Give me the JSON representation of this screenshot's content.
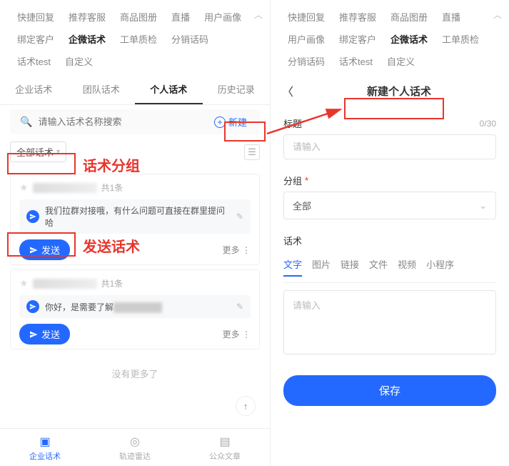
{
  "nav": {
    "tabs": [
      "快捷回复",
      "推荐客服",
      "商品图册",
      "直播",
      "用户画像",
      "绑定客户",
      "企微话术",
      "工单质检",
      "分销话码",
      "话术test",
      "自定义"
    ],
    "active_index": 6
  },
  "sub_tabs": {
    "items": [
      "企业话术",
      "团队话术",
      "个人话术",
      "历史记录"
    ],
    "active_index": 2
  },
  "search": {
    "placeholder": "请输入话术名称搜索",
    "new_label": "新建"
  },
  "filter": {
    "chip_label": "全部话术"
  },
  "cards": [
    {
      "count": "共1条",
      "msg": "我们拉群对接哦，有什么问题可直接在群里提问哈",
      "send": "发送",
      "more": "更多"
    },
    {
      "count": "共1条",
      "msg_prefix": "你好，是需要了解",
      "send": "发送",
      "more": "更多"
    }
  ],
  "no_more": "没有更多了",
  "bottom": {
    "items": [
      "企业话术",
      "轨迹雷达",
      "公众文章"
    ],
    "active_index": 0
  },
  "right": {
    "title": "新建个人话术",
    "label_title": "标题",
    "counter": "0/30",
    "placeholder_title": "请输入",
    "label_group": "分组",
    "group_value": "全部",
    "label_content": "话术",
    "content_tabs": [
      "文字",
      "图片",
      "链接",
      "文件",
      "视频",
      "小程序"
    ],
    "content_active": 0,
    "placeholder_content": "请输入",
    "save": "保存"
  },
  "annotations": {
    "group_label": "话术分组",
    "send_label": "发送话术"
  }
}
